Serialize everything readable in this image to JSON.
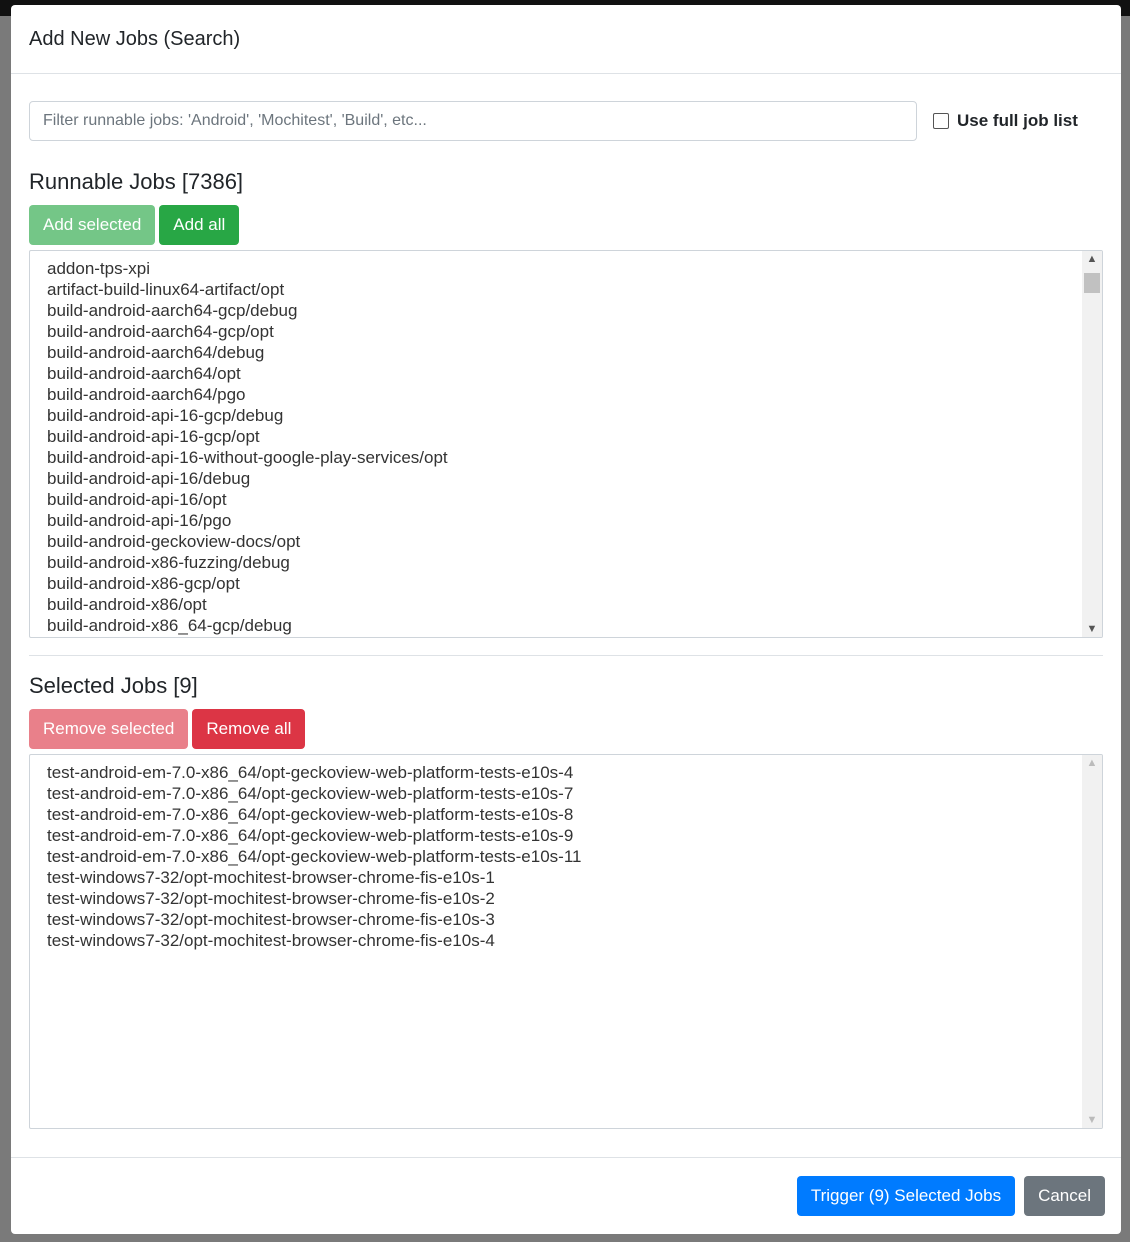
{
  "modal": {
    "title": "Add New Jobs (Search)",
    "filter_placeholder": "Filter runnable jobs: 'Android', 'Mochitest', 'Build', etc...",
    "full_list_label": "Use full job list",
    "full_list_checked": false,
    "runnable": {
      "heading": "Runnable Jobs [7386]",
      "add_selected": "Add selected",
      "add_all": "Add all",
      "items": [
        "addon-tps-xpi",
        "artifact-build-linux64-artifact/opt",
        "build-android-aarch64-gcp/debug",
        "build-android-aarch64-gcp/opt",
        "build-android-aarch64/debug",
        "build-android-aarch64/opt",
        "build-android-aarch64/pgo",
        "build-android-api-16-gcp/debug",
        "build-android-api-16-gcp/opt",
        "build-android-api-16-without-google-play-services/opt",
        "build-android-api-16/debug",
        "build-android-api-16/opt",
        "build-android-api-16/pgo",
        "build-android-geckoview-docs/opt",
        "build-android-x86-fuzzing/debug",
        "build-android-x86-gcp/opt",
        "build-android-x86/opt",
        "build-android-x86_64-gcp/debug"
      ]
    },
    "selected": {
      "heading": "Selected Jobs [9]",
      "remove_selected": "Remove selected",
      "remove_all": "Remove all",
      "items": [
        "test-android-em-7.0-x86_64/opt-geckoview-web-platform-tests-e10s-4",
        "test-android-em-7.0-x86_64/opt-geckoview-web-platform-tests-e10s-7",
        "test-android-em-7.0-x86_64/opt-geckoview-web-platform-tests-e10s-8",
        "test-android-em-7.0-x86_64/opt-geckoview-web-platform-tests-e10s-9",
        "test-android-em-7.0-x86_64/opt-geckoview-web-platform-tests-e10s-11",
        "test-windows7-32/opt-mochitest-browser-chrome-fis-e10s-1",
        "test-windows7-32/opt-mochitest-browser-chrome-fis-e10s-2",
        "test-windows7-32/opt-mochitest-browser-chrome-fis-e10s-3",
        "test-windows7-32/opt-mochitest-browser-chrome-fis-e10s-4"
      ]
    },
    "trigger_label": "Trigger (9) Selected Jobs",
    "cancel_label": "Cancel"
  }
}
